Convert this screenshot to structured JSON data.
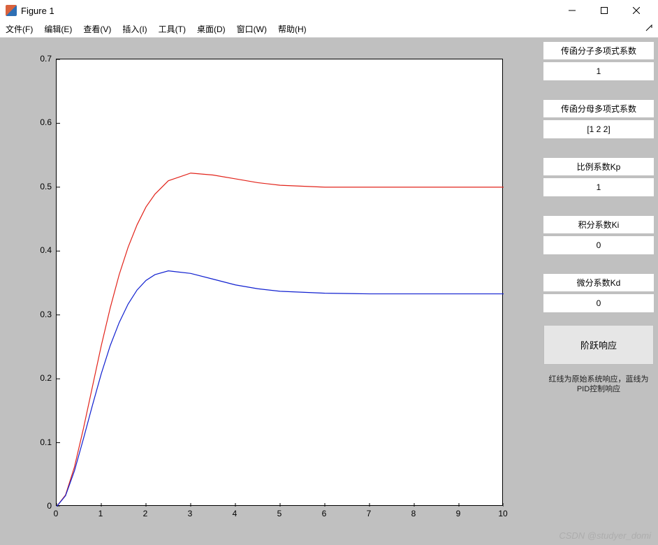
{
  "window": {
    "title": "Figure 1"
  },
  "menu": {
    "file": "文件(F)",
    "edit": "编辑(E)",
    "view": "查看(V)",
    "insert": "插入(I)",
    "tools": "工具(T)",
    "desktop": "桌面(D)",
    "window": "窗口(W)",
    "help": "帮助(H)"
  },
  "controls": {
    "num_label": "传函分子多项式系数",
    "num_value": "1",
    "den_label": "传函分母多项式系数",
    "den_value": "[1 2 2]",
    "kp_label": "比例系数Kp",
    "kp_value": "1",
    "ki_label": "积分系数Ki",
    "ki_value": "0",
    "kd_label": "微分系数Kd",
    "kd_value": "0",
    "step_button": "阶跃响应",
    "note": "红线为原始系统响应，蓝线为PID控制响应"
  },
  "watermark": "CSDN @studyer_domi",
  "chart_data": {
    "type": "line",
    "xlabel": "",
    "ylabel": "",
    "xlim": [
      0,
      10
    ],
    "ylim": [
      0,
      0.7
    ],
    "xticks": [
      0,
      1,
      2,
      3,
      4,
      5,
      6,
      7,
      8,
      9,
      10
    ],
    "yticks": [
      0,
      0.1,
      0.2,
      0.3,
      0.4,
      0.5,
      0.6,
      0.7
    ],
    "series": [
      {
        "name": "原始系统响应",
        "color": "#e2231a",
        "x": [
          0.0,
          0.2,
          0.4,
          0.6,
          0.8,
          1.0,
          1.2,
          1.4,
          1.6,
          1.8,
          2.0,
          2.2,
          2.5,
          3.0,
          3.5,
          4.0,
          4.5,
          5.0,
          6.0,
          7.0,
          8.0,
          9.0,
          10.0
        ],
        "y": [
          0.0,
          0.018,
          0.062,
          0.122,
          0.187,
          0.252,
          0.311,
          0.363,
          0.406,
          0.441,
          0.469,
          0.489,
          0.51,
          0.522,
          0.519,
          0.513,
          0.507,
          0.503,
          0.5,
          0.5,
          0.5,
          0.5,
          0.5
        ]
      },
      {
        "name": "PID控制响应",
        "color": "#1020d0",
        "x": [
          0.0,
          0.2,
          0.4,
          0.6,
          0.8,
          1.0,
          1.2,
          1.4,
          1.6,
          1.8,
          2.0,
          2.2,
          2.5,
          3.0,
          3.5,
          4.0,
          4.5,
          5.0,
          6.0,
          7.0,
          8.0,
          9.0,
          10.0
        ],
        "y": [
          0.0,
          0.017,
          0.056,
          0.106,
          0.158,
          0.208,
          0.252,
          0.288,
          0.317,
          0.339,
          0.354,
          0.363,
          0.369,
          0.365,
          0.356,
          0.347,
          0.341,
          0.337,
          0.334,
          0.333,
          0.333,
          0.333,
          0.333
        ]
      }
    ]
  }
}
